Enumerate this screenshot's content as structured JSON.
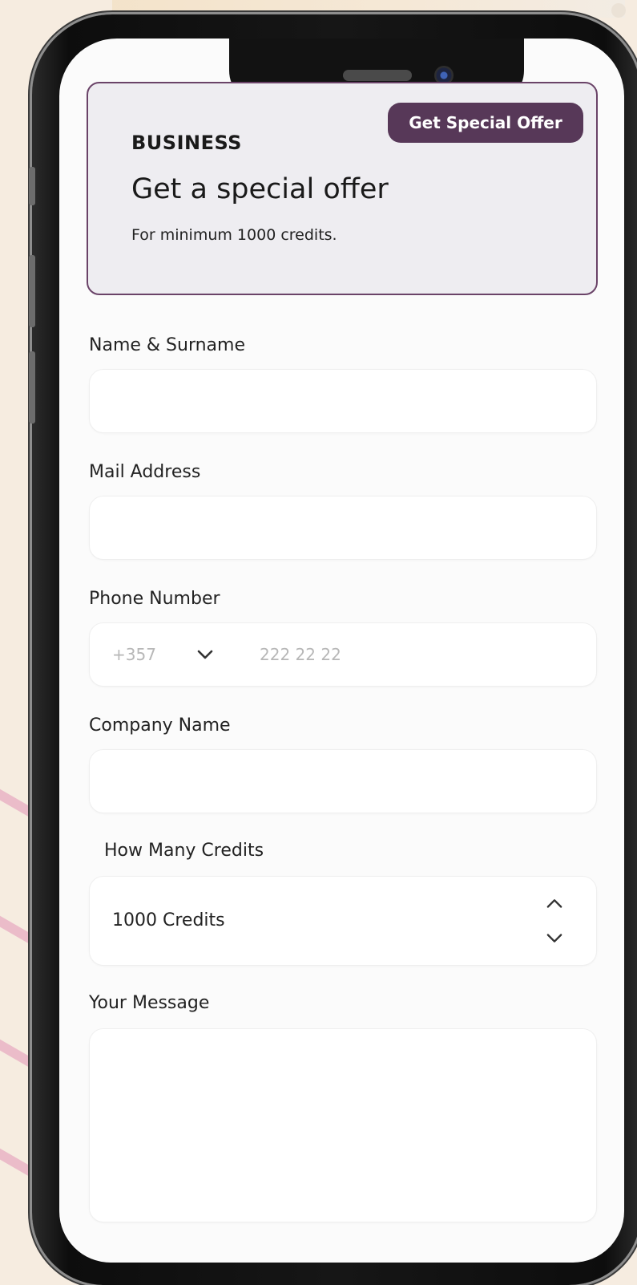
{
  "offer": {
    "button_label": "Get Special Offer",
    "tag": "BUSINESS",
    "title": "Get a special offer",
    "subtitle": "For minimum 1000 credits."
  },
  "form": {
    "name_label": "Name & Surname",
    "name_value": "",
    "mail_label": "Mail Address",
    "mail_value": "",
    "phone_label": "Phone Number",
    "phone_code": "+357",
    "phone_placeholder": "222 22 22",
    "company_label": "Company Name",
    "company_value": "",
    "credits_label": "How Many Credits",
    "credits_value": "1000 Credits",
    "message_label": "Your Message",
    "message_value": ""
  },
  "colors": {
    "accent": "#573858",
    "card_border": "#6a4368",
    "card_background": "#eeedf1",
    "page_background": "#f6ece0"
  },
  "icons": {
    "phone_code_dropdown": "chevron-down-icon",
    "credits_increment": "chevron-up-icon",
    "credits_decrement": "chevron-down-icon"
  }
}
